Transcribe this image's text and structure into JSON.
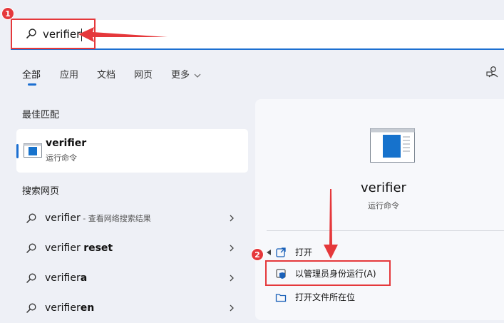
{
  "search": {
    "query": "verifier"
  },
  "annotations": {
    "step1": "1",
    "step2": "2"
  },
  "tabs": [
    {
      "label": "全部"
    },
    {
      "label": "应用"
    },
    {
      "label": "文档"
    },
    {
      "label": "网页"
    },
    {
      "label": "更多"
    }
  ],
  "best_match": {
    "section": "最佳匹配",
    "title": "verifier",
    "subtitle": "运行命令"
  },
  "web_search": {
    "section": "搜索网页",
    "items": [
      {
        "prefix": "verifier",
        "bold": "",
        "suffix": " - 查看网络搜索结果"
      },
      {
        "prefix": "verifier ",
        "bold": "reset",
        "suffix": ""
      },
      {
        "prefix": "verifier",
        "bold": "a",
        "suffix": ""
      },
      {
        "prefix": "verifier",
        "bold": "en",
        "suffix": ""
      }
    ]
  },
  "details": {
    "app_name": "verifier",
    "app_type": "运行命令",
    "actions": [
      {
        "label": "打开",
        "icon": "open-external-icon"
      },
      {
        "label": "以管理员身份运行(A)",
        "icon": "shield-icon"
      },
      {
        "label": "打开文件所在位",
        "icon": "folder-icon"
      }
    ]
  },
  "colors": {
    "accent": "#1c6fd1",
    "annotation": "#e5383b"
  }
}
